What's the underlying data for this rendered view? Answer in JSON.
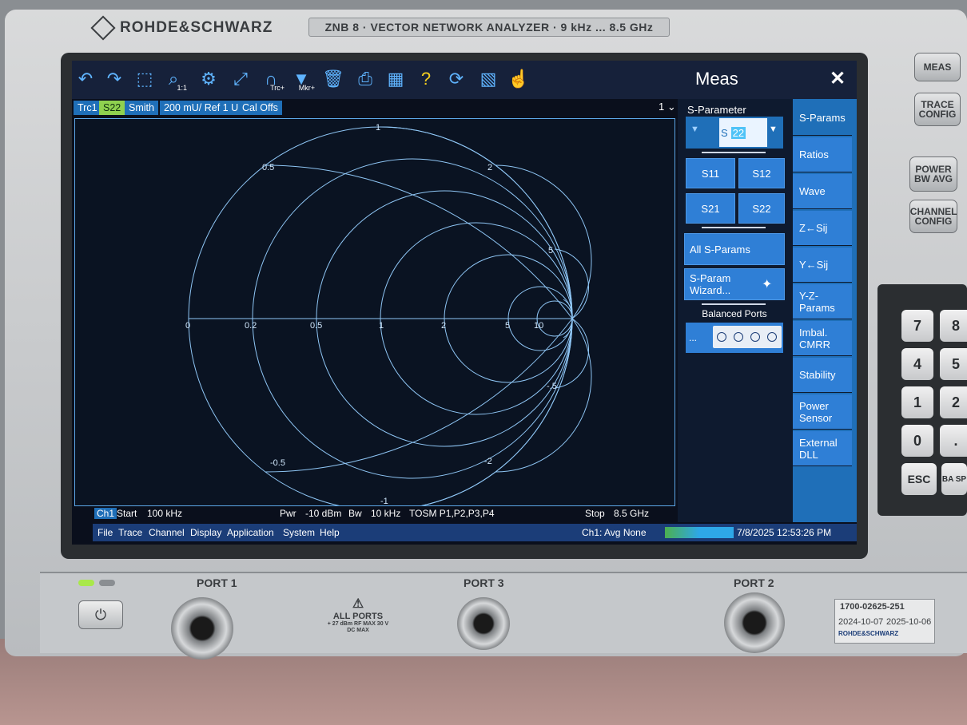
{
  "instrument": {
    "brand": "ROHDE&SCHWARZ",
    "model": "ZNB 8 · VECTOR NETWORK ANALYZER · 9 kHz ... 8.5 GHz"
  },
  "toolbar": {
    "icons": [
      "undo-icon",
      "redo-icon",
      "zoom-icon",
      "zoom-1to1-icon",
      "zoom-settings-icon",
      "fit-icon",
      "trace-add-icon",
      "marker-add-icon",
      "delete-icon",
      "print-icon",
      "windows-icon",
      "help-icon",
      "refresh-icon",
      "display-icon",
      "touch-icon"
    ],
    "trc_label": "Trc+",
    "mkr_label": "Mkr+",
    "one_to_one": "1:1"
  },
  "trace": {
    "name": "Trc1",
    "param": "S22",
    "format": "Smith",
    "scale": "200 mU/ Ref 1 U",
    "cal": "Cal Offs",
    "page": "1"
  },
  "smith": {
    "resistance_labels": [
      "0",
      "0.2",
      "0.5",
      "1",
      "2",
      "5",
      "10"
    ],
    "reactance_labels": [
      "1",
      "0.5",
      "2",
      ".5",
      "-.5",
      "-0.5",
      "-2",
      "-1",
      "5"
    ]
  },
  "channel": {
    "ch": "Ch1",
    "start_label": "Start",
    "start": "100 kHz",
    "pwr_label": "Pwr",
    "pwr": "-10 dBm",
    "bw_label": "Bw",
    "bw": "10 kHz",
    "cal": "TOSM P1,P2,P3,P4",
    "stop_label": "Stop",
    "stop": "8.5 GHz"
  },
  "menu": {
    "items": [
      "File",
      "Trace",
      "Channel",
      "Display",
      "Application",
      "System",
      "Help"
    ],
    "avg": "Ch1: Avg None",
    "datetime": "7/8/2025 12:53:26 PM"
  },
  "panel": {
    "title": "Meas",
    "sparam_header": "S-Parameter",
    "sparam_value_prefix": "S",
    "sparam_value": "22",
    "buttons": [
      "S11",
      "S12",
      "S21",
      "S22"
    ],
    "all_sparams": "All S-Params",
    "wizard": "S-Param Wizard...",
    "balanced_header": "Balanced Ports",
    "balanced_dots": "...",
    "tabs": [
      "S-Params",
      "Ratios",
      "Wave",
      "Z←Sij",
      "Y←Sij",
      "Y-Z-Params",
      "Imbal. CMRR",
      "Stability",
      "Power Sensor",
      "External DLL"
    ]
  },
  "hardware_keys": [
    "MEAS",
    "TRACE CONFIG",
    "POWER BW AVG",
    "CHANNEL CONFIG"
  ],
  "keypad": [
    "7",
    "8",
    "4",
    "5",
    "1",
    "2",
    "0",
    ".",
    "ESC",
    "BA SP"
  ],
  "front_panel": {
    "ports": [
      "PORT 1",
      "PORT 3",
      "PORT 2"
    ],
    "warning": "ALL PORTS",
    "warning_detail": "+ 27 dBm RF MAX 30 V DC MAX",
    "cal_id": "1700-02625-251",
    "cal_date": "2024-10-07",
    "due_date": "2025-10-06",
    "cal_brand": "ROHDE&SCHWARZ"
  }
}
